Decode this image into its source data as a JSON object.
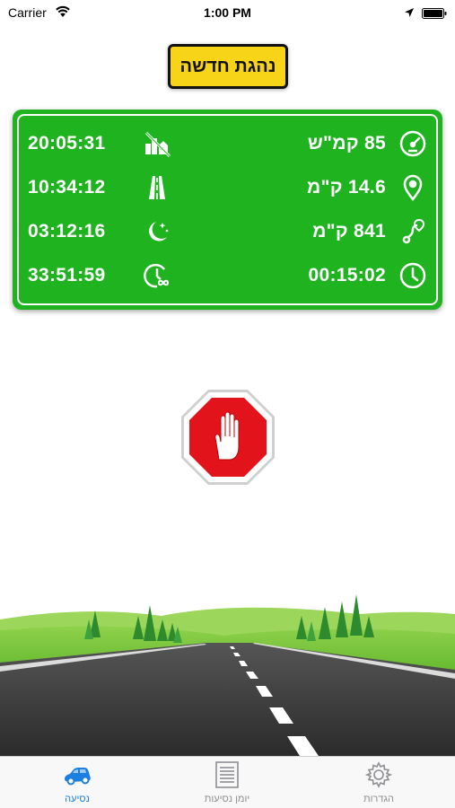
{
  "status_bar": {
    "carrier": "Carrier",
    "time": "1:00 PM"
  },
  "new_driver_sign": {
    "label": "נהגת חדשה",
    "color": "#f7d417"
  },
  "panel": {
    "color": "#1fb41f",
    "rows": [
      {
        "left_value": "20:05:31",
        "left_icon": "no-city-icon",
        "right_value": "85 קמ\"ש",
        "right_icon": "speedometer-icon"
      },
      {
        "left_value": "10:34:12",
        "left_icon": "highway-icon",
        "right_value": "14.6 ק\"מ",
        "right_icon": "location-pin-icon"
      },
      {
        "left_value": "03:12:16",
        "left_icon": "night-icon",
        "right_value": "841 ק\"מ",
        "right_icon": "route-icon"
      },
      {
        "left_value": "33:51:59",
        "left_icon": "total-time-icon",
        "right_value": "00:15:02",
        "right_icon": "clock-icon"
      }
    ]
  },
  "stop_button": {
    "icon": "stop-hand-icon",
    "color": "#e3131b"
  },
  "tab_bar": {
    "tabs": [
      {
        "label": "הגדרות",
        "icon": "gear-icon",
        "active": false
      },
      {
        "label": "יומן נסיעות",
        "icon": "list-icon",
        "active": false
      },
      {
        "label": "נסיעה",
        "icon": "car-icon",
        "active": true
      }
    ],
    "active_color": "#1b7fe0"
  }
}
